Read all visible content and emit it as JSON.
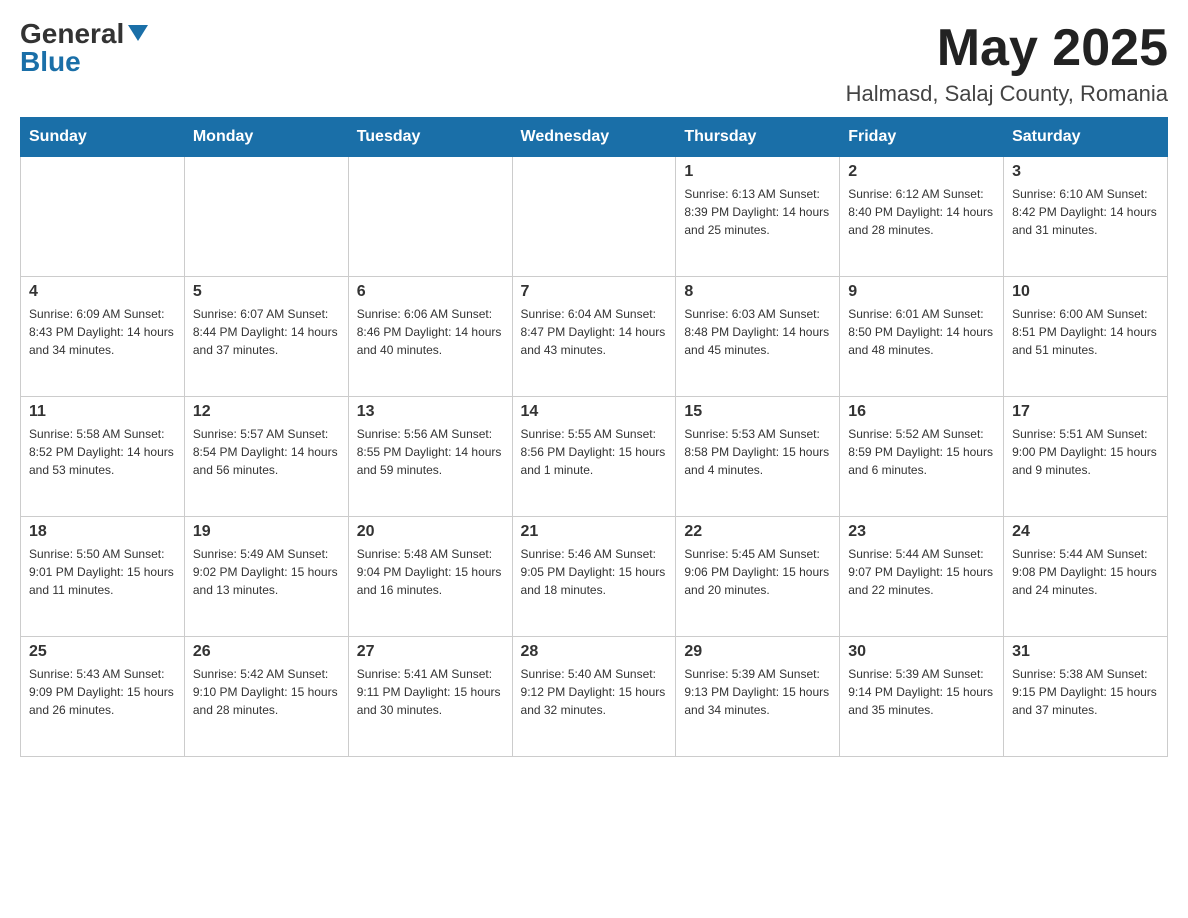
{
  "header": {
    "logo_general": "General",
    "logo_blue": "Blue",
    "month_title": "May 2025",
    "location": "Halmasd, Salaj County, Romania"
  },
  "weekdays": [
    "Sunday",
    "Monday",
    "Tuesday",
    "Wednesday",
    "Thursday",
    "Friday",
    "Saturday"
  ],
  "weeks": [
    [
      {
        "day": "",
        "info": ""
      },
      {
        "day": "",
        "info": ""
      },
      {
        "day": "",
        "info": ""
      },
      {
        "day": "",
        "info": ""
      },
      {
        "day": "1",
        "info": "Sunrise: 6:13 AM\nSunset: 8:39 PM\nDaylight: 14 hours\nand 25 minutes."
      },
      {
        "day": "2",
        "info": "Sunrise: 6:12 AM\nSunset: 8:40 PM\nDaylight: 14 hours\nand 28 minutes."
      },
      {
        "day": "3",
        "info": "Sunrise: 6:10 AM\nSunset: 8:42 PM\nDaylight: 14 hours\nand 31 minutes."
      }
    ],
    [
      {
        "day": "4",
        "info": "Sunrise: 6:09 AM\nSunset: 8:43 PM\nDaylight: 14 hours\nand 34 minutes."
      },
      {
        "day": "5",
        "info": "Sunrise: 6:07 AM\nSunset: 8:44 PM\nDaylight: 14 hours\nand 37 minutes."
      },
      {
        "day": "6",
        "info": "Sunrise: 6:06 AM\nSunset: 8:46 PM\nDaylight: 14 hours\nand 40 minutes."
      },
      {
        "day": "7",
        "info": "Sunrise: 6:04 AM\nSunset: 8:47 PM\nDaylight: 14 hours\nand 43 minutes."
      },
      {
        "day": "8",
        "info": "Sunrise: 6:03 AM\nSunset: 8:48 PM\nDaylight: 14 hours\nand 45 minutes."
      },
      {
        "day": "9",
        "info": "Sunrise: 6:01 AM\nSunset: 8:50 PM\nDaylight: 14 hours\nand 48 minutes."
      },
      {
        "day": "10",
        "info": "Sunrise: 6:00 AM\nSunset: 8:51 PM\nDaylight: 14 hours\nand 51 minutes."
      }
    ],
    [
      {
        "day": "11",
        "info": "Sunrise: 5:58 AM\nSunset: 8:52 PM\nDaylight: 14 hours\nand 53 minutes."
      },
      {
        "day": "12",
        "info": "Sunrise: 5:57 AM\nSunset: 8:54 PM\nDaylight: 14 hours\nand 56 minutes."
      },
      {
        "day": "13",
        "info": "Sunrise: 5:56 AM\nSunset: 8:55 PM\nDaylight: 14 hours\nand 59 minutes."
      },
      {
        "day": "14",
        "info": "Sunrise: 5:55 AM\nSunset: 8:56 PM\nDaylight: 15 hours\nand 1 minute."
      },
      {
        "day": "15",
        "info": "Sunrise: 5:53 AM\nSunset: 8:58 PM\nDaylight: 15 hours\nand 4 minutes."
      },
      {
        "day": "16",
        "info": "Sunrise: 5:52 AM\nSunset: 8:59 PM\nDaylight: 15 hours\nand 6 minutes."
      },
      {
        "day": "17",
        "info": "Sunrise: 5:51 AM\nSunset: 9:00 PM\nDaylight: 15 hours\nand 9 minutes."
      }
    ],
    [
      {
        "day": "18",
        "info": "Sunrise: 5:50 AM\nSunset: 9:01 PM\nDaylight: 15 hours\nand 11 minutes."
      },
      {
        "day": "19",
        "info": "Sunrise: 5:49 AM\nSunset: 9:02 PM\nDaylight: 15 hours\nand 13 minutes."
      },
      {
        "day": "20",
        "info": "Sunrise: 5:48 AM\nSunset: 9:04 PM\nDaylight: 15 hours\nand 16 minutes."
      },
      {
        "day": "21",
        "info": "Sunrise: 5:46 AM\nSunset: 9:05 PM\nDaylight: 15 hours\nand 18 minutes."
      },
      {
        "day": "22",
        "info": "Sunrise: 5:45 AM\nSunset: 9:06 PM\nDaylight: 15 hours\nand 20 minutes."
      },
      {
        "day": "23",
        "info": "Sunrise: 5:44 AM\nSunset: 9:07 PM\nDaylight: 15 hours\nand 22 minutes."
      },
      {
        "day": "24",
        "info": "Sunrise: 5:44 AM\nSunset: 9:08 PM\nDaylight: 15 hours\nand 24 minutes."
      }
    ],
    [
      {
        "day": "25",
        "info": "Sunrise: 5:43 AM\nSunset: 9:09 PM\nDaylight: 15 hours\nand 26 minutes."
      },
      {
        "day": "26",
        "info": "Sunrise: 5:42 AM\nSunset: 9:10 PM\nDaylight: 15 hours\nand 28 minutes."
      },
      {
        "day": "27",
        "info": "Sunrise: 5:41 AM\nSunset: 9:11 PM\nDaylight: 15 hours\nand 30 minutes."
      },
      {
        "day": "28",
        "info": "Sunrise: 5:40 AM\nSunset: 9:12 PM\nDaylight: 15 hours\nand 32 minutes."
      },
      {
        "day": "29",
        "info": "Sunrise: 5:39 AM\nSunset: 9:13 PM\nDaylight: 15 hours\nand 34 minutes."
      },
      {
        "day": "30",
        "info": "Sunrise: 5:39 AM\nSunset: 9:14 PM\nDaylight: 15 hours\nand 35 minutes."
      },
      {
        "day": "31",
        "info": "Sunrise: 5:38 AM\nSunset: 9:15 PM\nDaylight: 15 hours\nand 37 minutes."
      }
    ]
  ]
}
